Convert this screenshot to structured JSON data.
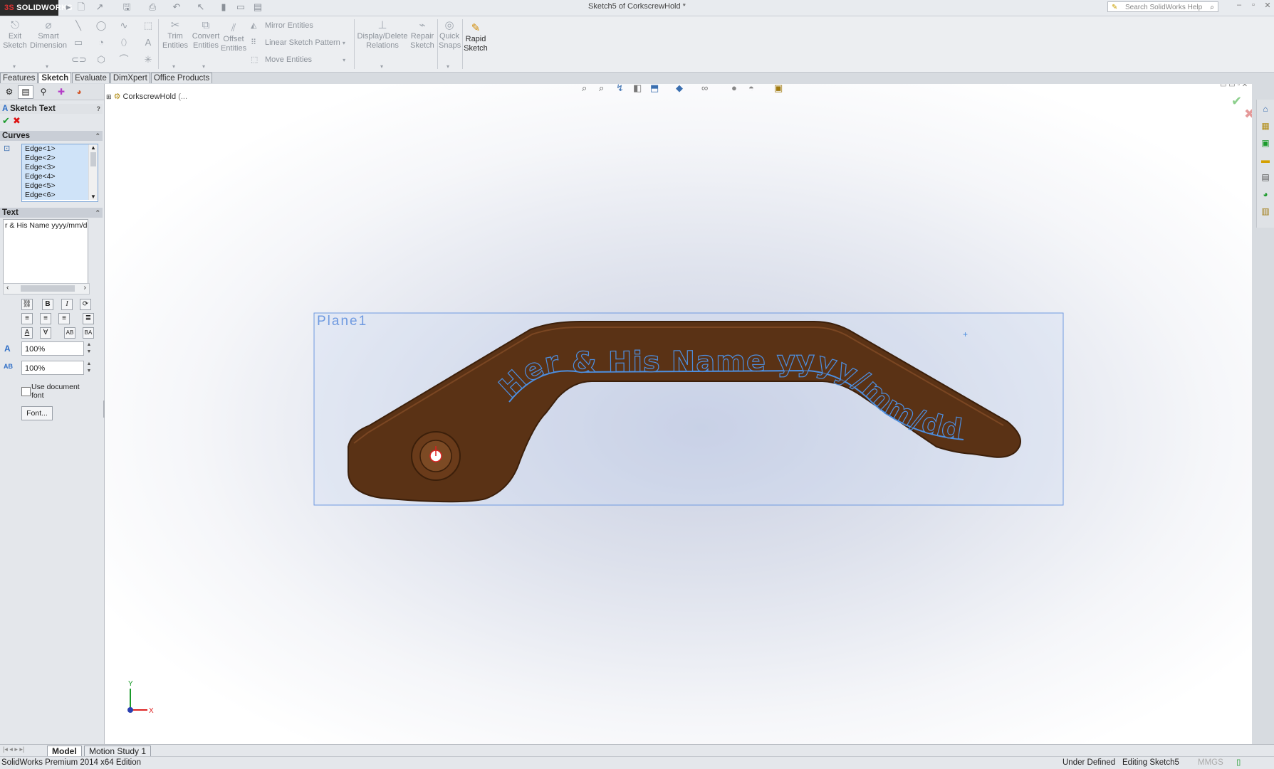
{
  "app": {
    "logo": "SOLIDWORKS",
    "logo_prefix": "3S",
    "document_title": "Sketch5 of CorkscrewHold *"
  },
  "search": {
    "placeholder": "Search SolidWorks Help"
  },
  "toolbar": {
    "exit_sketch": "Exit Sketch",
    "smart_dimension": "Smart Dimension",
    "trim_entities": "Trim Entities",
    "convert_entities": "Convert Entities",
    "offset_entities": "Offset Entities",
    "mirror_entities": "Mirror Entities",
    "linear_sketch_pattern": "Linear Sketch Pattern",
    "move_entities": "Move Entities",
    "display_delete_relations": "Display/Delete Relations",
    "repair_sketch": "Repair Sketch",
    "quick_snaps": "Quick Snaps",
    "rapid_sketch": "Rapid Sketch"
  },
  "tabs": [
    "Features",
    "Sketch",
    "Evaluate",
    "DimXpert",
    "Office Products"
  ],
  "active_tab": "Sketch",
  "property_manager": {
    "title": "Sketch Text",
    "help": "?",
    "curves_header": "Curves",
    "curves": [
      "Edge<1>",
      "Edge<2>",
      "Edge<3>",
      "Edge<4>",
      "Edge<5>",
      "Edge<6>"
    ],
    "text_header": "Text",
    "text_value": "r & His Name yyyy/mm/dd",
    "bold_label": "B",
    "italic_label": "I",
    "width_factor": "100%",
    "spacing": "100%",
    "use_document_font": "Use document font",
    "font_button": "Font..."
  },
  "feature_tree": {
    "root": "CorkscrewHold",
    "root_suffix": "(..."
  },
  "viewport": {
    "plane_label": "Plane1",
    "sketch_text": "Her & His Name yyyy/mm/dd",
    "triad_y": "Y",
    "triad_x": "X"
  },
  "colors": {
    "part": "#5a3215",
    "part_edge": "#3b1f0a",
    "sketch": "#4d8fe0",
    "plane": "#6f9ae0"
  },
  "model_tabs": [
    "Model",
    "Motion Study 1"
  ],
  "status": {
    "edition": "SolidWorks Premium 2014 x64 Edition",
    "state": "Under Defined",
    "editing": "Editing Sketch5",
    "units": "MMGS"
  }
}
